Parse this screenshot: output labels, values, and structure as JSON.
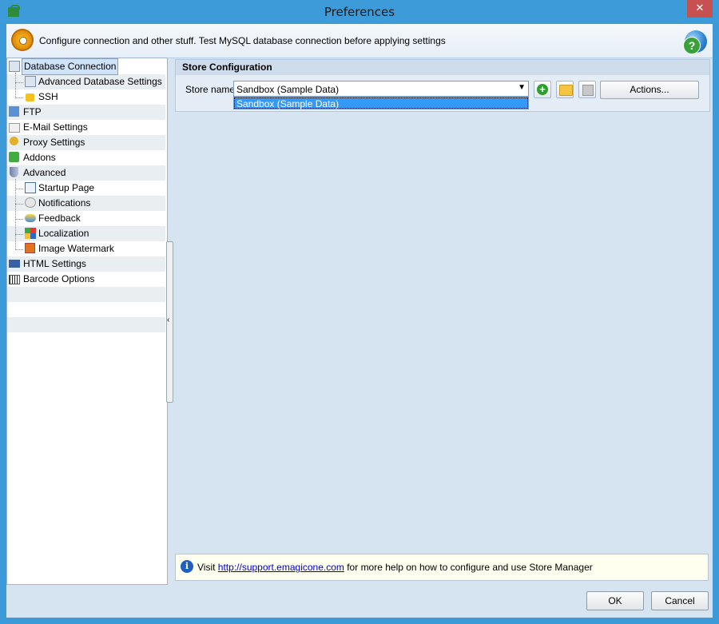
{
  "window": {
    "title": "Preferences",
    "close_glyph": "✕"
  },
  "header": {
    "description": "Configure connection and other stuff. Test MySQL database connection before applying settings",
    "help_glyph": "?"
  },
  "tree": {
    "items": [
      {
        "label": "Database Connection",
        "icon": "database-icon",
        "level": 0,
        "selected": true
      },
      {
        "label": "Advanced Database Settings",
        "icon": "database-settings-icon",
        "level": 1
      },
      {
        "label": "SSH",
        "icon": "lock-icon",
        "level": 1
      },
      {
        "label": "FTP",
        "icon": "ftp-icon",
        "level": 0
      },
      {
        "label": "E-Mail Settings",
        "icon": "email-icon",
        "level": 0
      },
      {
        "label": "Proxy Settings",
        "icon": "proxy-icon",
        "level": 0
      },
      {
        "label": "Addons",
        "icon": "addons-icon",
        "level": 0
      },
      {
        "label": "Advanced",
        "icon": "shield-icon",
        "level": 0
      },
      {
        "label": "Startup Page",
        "icon": "startup-page-icon",
        "level": 1
      },
      {
        "label": "Notifications",
        "icon": "notifications-icon",
        "level": 1
      },
      {
        "label": "Feedback",
        "icon": "feedback-icon",
        "level": 1
      },
      {
        "label": "Localization",
        "icon": "localization-icon",
        "level": 1
      },
      {
        "label": "Image Watermark",
        "icon": "watermark-icon",
        "level": 1
      },
      {
        "label": "HTML Settings",
        "icon": "html-icon",
        "level": 0
      },
      {
        "label": "Barcode Options",
        "icon": "barcode-icon",
        "level": 0
      }
    ]
  },
  "store_config": {
    "title": "Store Configuration",
    "store_name_label": "Store name",
    "selected_value": "Sandbox (Sample Data)",
    "dropdown_options": [
      "Sandbox (Sample Data)"
    ],
    "add_glyph": "+",
    "actions_label": "Actions..."
  },
  "info": {
    "prefix": "Visit ",
    "link": "http://support.emagicone.com",
    "suffix": " for more help on how to configure and use Store Manager",
    "glyph": "i"
  },
  "footer": {
    "ok_label": "OK",
    "cancel_label": "Cancel"
  },
  "colors": {
    "titlebar": "#3e9bd9",
    "client_bg": "#d6e3f1",
    "selection": "#3399ff",
    "close_button": "#c75050"
  }
}
